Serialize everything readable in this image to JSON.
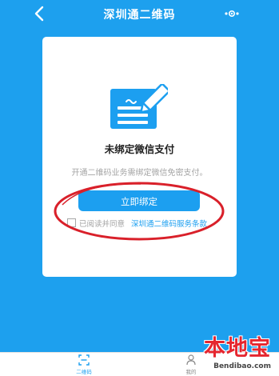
{
  "navbar": {
    "title": "深圳通二维码",
    "back_icon": "chevron-left-icon",
    "more_icon": "more-dots-icon"
  },
  "card": {
    "icon": "sign-document-pen-icon",
    "title": "未绑定微信支付",
    "description": "开通二维码业务需绑定微信免密支付。",
    "bind_button_label": "立即绑定",
    "agree_label": "已阅读并同意",
    "terms_link": "深圳通二维码服务条款",
    "agree_checked": false
  },
  "tabbar": {
    "items": [
      {
        "label": "二维码",
        "icon": "qrcode-scan-icon",
        "active": true
      },
      {
        "label": "我的",
        "icon": "person-icon",
        "active": false
      }
    ]
  },
  "watermark": {
    "chars": "本地宝",
    "url": "Bendibao.com"
  },
  "colors": {
    "primary_blue": "#1da0ee",
    "button_blue": "#1c9ff0",
    "annotation_red": "#d9202a",
    "watermark_red": "#e5262f"
  }
}
